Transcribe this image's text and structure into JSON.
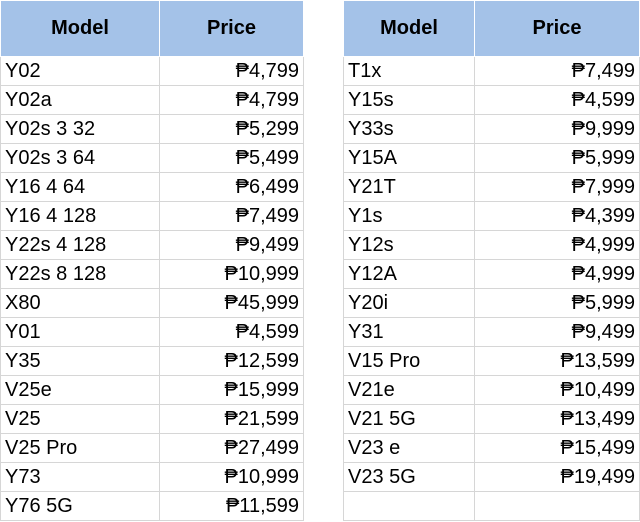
{
  "headers": {
    "model": "Model",
    "price": "Price"
  },
  "left_table": [
    {
      "model": "Y02",
      "price": "₱4,799"
    },
    {
      "model": "Y02a",
      "price": "₱4,799"
    },
    {
      "model": "Y02s 3 32",
      "price": "₱5,299"
    },
    {
      "model": "Y02s 3 64",
      "price": "₱5,499"
    },
    {
      "model": "Y16 4 64",
      "price": "₱6,499"
    },
    {
      "model": "Y16 4 128",
      "price": "₱7,499"
    },
    {
      "model": "Y22s 4 128",
      "price": "₱9,499"
    },
    {
      "model": "Y22s 8 128",
      "price": "₱10,999"
    },
    {
      "model": "X80",
      "price": "₱45,999"
    },
    {
      "model": "Y01",
      "price": "₱4,599"
    },
    {
      "model": "Y35",
      "price": "₱12,599"
    },
    {
      "model": "V25e",
      "price": "₱15,999"
    },
    {
      "model": "V25",
      "price": "₱21,599"
    },
    {
      "model": "V25 Pro",
      "price": "₱27,499"
    },
    {
      "model": "Y73",
      "price": "₱10,999"
    },
    {
      "model": "Y76 5G",
      "price": "₱11,599"
    }
  ],
  "right_table": [
    {
      "model": "T1x",
      "price": "₱7,499"
    },
    {
      "model": "Y15s",
      "price": "₱4,599"
    },
    {
      "model": "Y33s",
      "price": "₱9,999"
    },
    {
      "model": "Y15A",
      "price": "₱5,999"
    },
    {
      "model": "Y21T",
      "price": "₱7,999"
    },
    {
      "model": "Y1s",
      "price": "₱4,399"
    },
    {
      "model": "Y12s",
      "price": "₱4,999"
    },
    {
      "model": "Y12A",
      "price": "₱4,999"
    },
    {
      "model": "Y20i",
      "price": "₱5,999"
    },
    {
      "model": "Y31",
      "price": "₱9,499"
    },
    {
      "model": "V15 Pro",
      "price": "₱13,599"
    },
    {
      "model": "V21e",
      "price": "₱10,499"
    },
    {
      "model": "V21 5G",
      "price": "₱13,499"
    },
    {
      "model": "V23 e",
      "price": "₱15,499"
    },
    {
      "model": "V23 5G",
      "price": "₱19,499"
    },
    {
      "model": "",
      "price": ""
    }
  ],
  "colors": {
    "header_bg": "#a4c2e8",
    "grid_line": "#d6d6d6"
  }
}
